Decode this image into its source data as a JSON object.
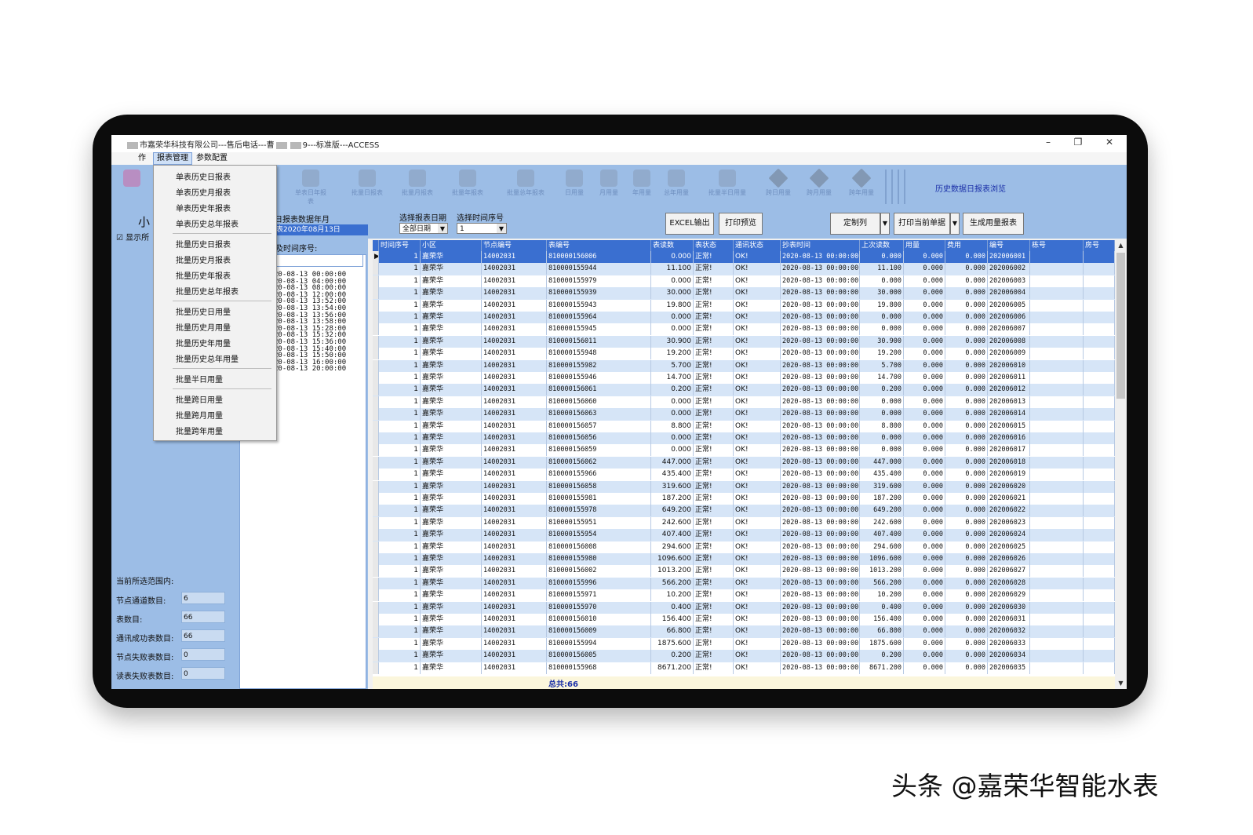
{
  "window": {
    "title_prefix": "市嘉荣华科技有限公司---售后电话---曹",
    "title_suffix": "9---标准版---ACCESS",
    "min_label": "–",
    "restore_label": "❐",
    "close_label": "✕"
  },
  "menu": {
    "items": [
      "作",
      "报表管理",
      "参数配置"
    ]
  },
  "toolbar": {
    "buttons": [
      "单表日年报表",
      "批量日报表",
      "批量月报表",
      "批量年报表",
      "批量总年报表",
      "日用量",
      "月用量",
      "年用量",
      "总年用量",
      "批量半日用量",
      "跨日用量",
      "跨月用量",
      "跨年用量"
    ],
    "history_link": "历史数据日报表浏览"
  },
  "left_panel": {
    "title": "小",
    "show_all": "显示所",
    "range_label": "当前所选范围内:",
    "stats": [
      {
        "label": "节点通道数目:",
        "value": "6"
      },
      {
        "label": "表数目:",
        "value": "66"
      },
      {
        "label": "通讯成功表数目:",
        "value": "66"
      },
      {
        "label": "节点失败表数目:",
        "value": "0"
      },
      {
        "label": "读表失败表数目:",
        "value": "0"
      }
    ]
  },
  "mid_panel": {
    "month_label": "日报表数据年月",
    "date_value": "表2020年08月13日",
    "seq_label": "及时间序号:",
    "times": [
      "20-08-13 00:00:00",
      "20-08-13 04:00:00",
      "20-08-13 08:00:00",
      "20-08-13 12:00:00",
      "20-08-13 13:52:00",
      "20-08-13 13:54:00",
      "20-08-13 13:56:00",
      "20-08-13 13:58:00",
      "20-08-13 15:28:00",
      "20-08-13 15:32:00",
      "20-08-13 15:36:00",
      "20-08-13 15:40:00",
      "20-08-13 15:50:00",
      "20-08-13 16:00:00",
      "20-08-13 20:00:00"
    ]
  },
  "controls": {
    "date_label": "选择报表日期",
    "date_value": "全部日期",
    "seq_label": "选择时间序号",
    "seq_value": "1",
    "excel_button": "EXCEL输出",
    "print_preview_button": "打印预览",
    "custom_col_button": "定制列",
    "print_current_button": "打印当前单据",
    "gen_report_button": "生成用量报表"
  },
  "dropdown_menu": {
    "groups": [
      [
        "单表历史日报表",
        "单表历史月报表",
        "单表历史年报表",
        "单表历史总年报表"
      ],
      [
        "批量历史日报表",
        "批量历史月报表",
        "批量历史年报表",
        "批量历史总年报表"
      ],
      [
        "批量历史日用量",
        "批量历史月用量",
        "批量历史年用量",
        "批量历史总年用量"
      ],
      [
        "批量半日用量"
      ],
      [
        "批量跨日用量",
        "批量跨月用量",
        "批量跨年用量"
      ]
    ]
  },
  "table": {
    "columns": [
      "时间序号",
      "小区",
      "节点编号",
      "表编号",
      "表读数",
      "表状态",
      "通讯状态",
      "抄表时间",
      "上次读数",
      "用量",
      "费用",
      "编号",
      "栋号",
      "房号"
    ],
    "rows": [
      [
        "1",
        "嘉荣华",
        "14002031",
        "810000156006",
        "0.000",
        "正常!",
        "OK!",
        "2020-08-13 00:00:00",
        "0.000",
        "0.000",
        "0.000",
        "202006001",
        "",
        ""
      ],
      [
        "1",
        "嘉荣华",
        "14002031",
        "810000155944",
        "11.100",
        "正常!",
        "OK!",
        "2020-08-13 00:00:00",
        "11.100",
        "0.000",
        "0.000",
        "202006002",
        "",
        ""
      ],
      [
        "1",
        "嘉荣华",
        "14002031",
        "810000155979",
        "0.000",
        "正常!",
        "OK!",
        "2020-08-13 00:00:00",
        "0.000",
        "0.000",
        "0.000",
        "202006003",
        "",
        ""
      ],
      [
        "1",
        "嘉荣华",
        "14002031",
        "810000155939",
        "30.000",
        "正常!",
        "OK!",
        "2020-08-13 00:00:00",
        "30.000",
        "0.000",
        "0.000",
        "202006004",
        "",
        ""
      ],
      [
        "1",
        "嘉荣华",
        "14002031",
        "810000155943",
        "19.800",
        "正常!",
        "OK!",
        "2020-08-13 00:00:00",
        "19.800",
        "0.000",
        "0.000",
        "202006005",
        "",
        ""
      ],
      [
        "1",
        "嘉荣华",
        "14002031",
        "810000155964",
        "0.000",
        "正常!",
        "OK!",
        "2020-08-13 00:00:00",
        "0.000",
        "0.000",
        "0.000",
        "202006006",
        "",
        ""
      ],
      [
        "1",
        "嘉荣华",
        "14002031",
        "810000155945",
        "0.000",
        "正常!",
        "OK!",
        "2020-08-13 00:00:00",
        "0.000",
        "0.000",
        "0.000",
        "202006007",
        "",
        ""
      ],
      [
        "1",
        "嘉荣华",
        "14002031",
        "810000156011",
        "30.900",
        "正常!",
        "OK!",
        "2020-08-13 00:00:00",
        "30.900",
        "0.000",
        "0.000",
        "202006008",
        "",
        ""
      ],
      [
        "1",
        "嘉荣华",
        "14002031",
        "810000155948",
        "19.200",
        "正常!",
        "OK!",
        "2020-08-13 00:00:00",
        "19.200",
        "0.000",
        "0.000",
        "202006009",
        "",
        ""
      ],
      [
        "1",
        "嘉荣华",
        "14002031",
        "810000155982",
        "5.700",
        "正常!",
        "OK!",
        "2020-08-13 00:00:00",
        "5.700",
        "0.000",
        "0.000",
        "202006010",
        "",
        ""
      ],
      [
        "1",
        "嘉荣华",
        "14002031",
        "810000155946",
        "14.700",
        "正常!",
        "OK!",
        "2020-08-13 00:00:00",
        "14.700",
        "0.000",
        "0.000",
        "202006011",
        "",
        ""
      ],
      [
        "1",
        "嘉荣华",
        "14002031",
        "810000156061",
        "0.200",
        "正常!",
        "OK!",
        "2020-08-13 00:00:00",
        "0.200",
        "0.000",
        "0.000",
        "202006012",
        "",
        ""
      ],
      [
        "1",
        "嘉荣华",
        "14002031",
        "810000156060",
        "0.000",
        "正常!",
        "OK!",
        "2020-08-13 00:00:00",
        "0.000",
        "0.000",
        "0.000",
        "202006013",
        "",
        ""
      ],
      [
        "1",
        "嘉荣华",
        "14002031",
        "810000156063",
        "0.000",
        "正常!",
        "OK!",
        "2020-08-13 00:00:00",
        "0.000",
        "0.000",
        "0.000",
        "202006014",
        "",
        ""
      ],
      [
        "1",
        "嘉荣华",
        "14002031",
        "810000156057",
        "8.800",
        "正常!",
        "OK!",
        "2020-08-13 00:00:00",
        "8.800",
        "0.000",
        "0.000",
        "202006015",
        "",
        ""
      ],
      [
        "1",
        "嘉荣华",
        "14002031",
        "810000156056",
        "0.000",
        "正常!",
        "OK!",
        "2020-08-13 00:00:00",
        "0.000",
        "0.000",
        "0.000",
        "202006016",
        "",
        ""
      ],
      [
        "1",
        "嘉荣华",
        "14002031",
        "810000156059",
        "0.000",
        "正常!",
        "OK!",
        "2020-08-13 00:00:00",
        "0.000",
        "0.000",
        "0.000",
        "202006017",
        "",
        ""
      ],
      [
        "1",
        "嘉荣华",
        "14002031",
        "810000156062",
        "447.000",
        "正常!",
        "OK!",
        "2020-08-13 00:00:00",
        "447.000",
        "0.000",
        "0.000",
        "202006018",
        "",
        ""
      ],
      [
        "1",
        "嘉荣华",
        "14002031",
        "810000155966",
        "435.400",
        "正常!",
        "OK!",
        "2020-08-13 00:00:00",
        "435.400",
        "0.000",
        "0.000",
        "202006019",
        "",
        ""
      ],
      [
        "1",
        "嘉荣华",
        "14002031",
        "810000156058",
        "319.600",
        "正常!",
        "OK!",
        "2020-08-13 00:00:00",
        "319.600",
        "0.000",
        "0.000",
        "202006020",
        "",
        ""
      ],
      [
        "1",
        "嘉荣华",
        "14002031",
        "810000155981",
        "187.200",
        "正常!",
        "OK!",
        "2020-08-13 00:00:00",
        "187.200",
        "0.000",
        "0.000",
        "202006021",
        "",
        ""
      ],
      [
        "1",
        "嘉荣华",
        "14002031",
        "810000155978",
        "649.200",
        "正常!",
        "OK!",
        "2020-08-13 00:00:00",
        "649.200",
        "0.000",
        "0.000",
        "202006022",
        "",
        ""
      ],
      [
        "1",
        "嘉荣华",
        "14002031",
        "810000155951",
        "242.600",
        "正常!",
        "OK!",
        "2020-08-13 00:00:00",
        "242.600",
        "0.000",
        "0.000",
        "202006023",
        "",
        ""
      ],
      [
        "1",
        "嘉荣华",
        "14002031",
        "810000155954",
        "407.400",
        "正常!",
        "OK!",
        "2020-08-13 00:00:00",
        "407.400",
        "0.000",
        "0.000",
        "202006024",
        "",
        ""
      ],
      [
        "1",
        "嘉荣华",
        "14002031",
        "810000156008",
        "294.600",
        "正常!",
        "OK!",
        "2020-08-13 00:00:00",
        "294.600",
        "0.000",
        "0.000",
        "202006025",
        "",
        ""
      ],
      [
        "1",
        "嘉荣华",
        "14002031",
        "810000155980",
        "1096.600",
        "正常!",
        "OK!",
        "2020-08-13 00:00:00",
        "1096.600",
        "0.000",
        "0.000",
        "202006026",
        "",
        ""
      ],
      [
        "1",
        "嘉荣华",
        "14002031",
        "810000156002",
        "1013.200",
        "正常!",
        "OK!",
        "2020-08-13 00:00:00",
        "1013.200",
        "0.000",
        "0.000",
        "202006027",
        "",
        ""
      ],
      [
        "1",
        "嘉荣华",
        "14002031",
        "810000155996",
        "566.200",
        "正常!",
        "OK!",
        "2020-08-13 00:00:00",
        "566.200",
        "0.000",
        "0.000",
        "202006028",
        "",
        ""
      ],
      [
        "1",
        "嘉荣华",
        "14002031",
        "810000155971",
        "10.200",
        "正常!",
        "OK!",
        "2020-08-13 00:00:00",
        "10.200",
        "0.000",
        "0.000",
        "202006029",
        "",
        ""
      ],
      [
        "1",
        "嘉荣华",
        "14002031",
        "810000155970",
        "0.400",
        "正常!",
        "OK!",
        "2020-08-13 00:00:00",
        "0.400",
        "0.000",
        "0.000",
        "202006030",
        "",
        ""
      ],
      [
        "1",
        "嘉荣华",
        "14002031",
        "810000156010",
        "156.400",
        "正常!",
        "OK!",
        "2020-08-13 00:00:00",
        "156.400",
        "0.000",
        "0.000",
        "202006031",
        "",
        ""
      ],
      [
        "1",
        "嘉荣华",
        "14002031",
        "810000156009",
        "66.800",
        "正常!",
        "OK!",
        "2020-08-13 00:00:00",
        "66.800",
        "0.000",
        "0.000",
        "202006032",
        "",
        ""
      ],
      [
        "1",
        "嘉荣华",
        "14002031",
        "810000155994",
        "1875.600",
        "正常!",
        "OK!",
        "2020-08-13 00:00:00",
        "1875.600",
        "0.000",
        "0.000",
        "202006033",
        "",
        ""
      ],
      [
        "1",
        "嘉荣华",
        "14002031",
        "810000156005",
        "0.200",
        "正常!",
        "OK!",
        "2020-08-13 00:00:00",
        "0.200",
        "0.000",
        "0.000",
        "202006034",
        "",
        ""
      ],
      [
        "1",
        "嘉荣华",
        "14002031",
        "810000155968",
        "8671.200",
        "正常!",
        "OK!",
        "2020-08-13 00:00:00",
        "8671.200",
        "0.000",
        "0.000",
        "202006035",
        "",
        ""
      ]
    ],
    "total_label": "总共:66",
    "selected_row": 0
  },
  "caption": "头条 @嘉荣华智能水表",
  "colors": {
    "panel_blue": "#9cbde6",
    "header_blue": "#3a6fd0",
    "row_alt": "#d6e5f7",
    "bezel": "#0c0c0c"
  }
}
